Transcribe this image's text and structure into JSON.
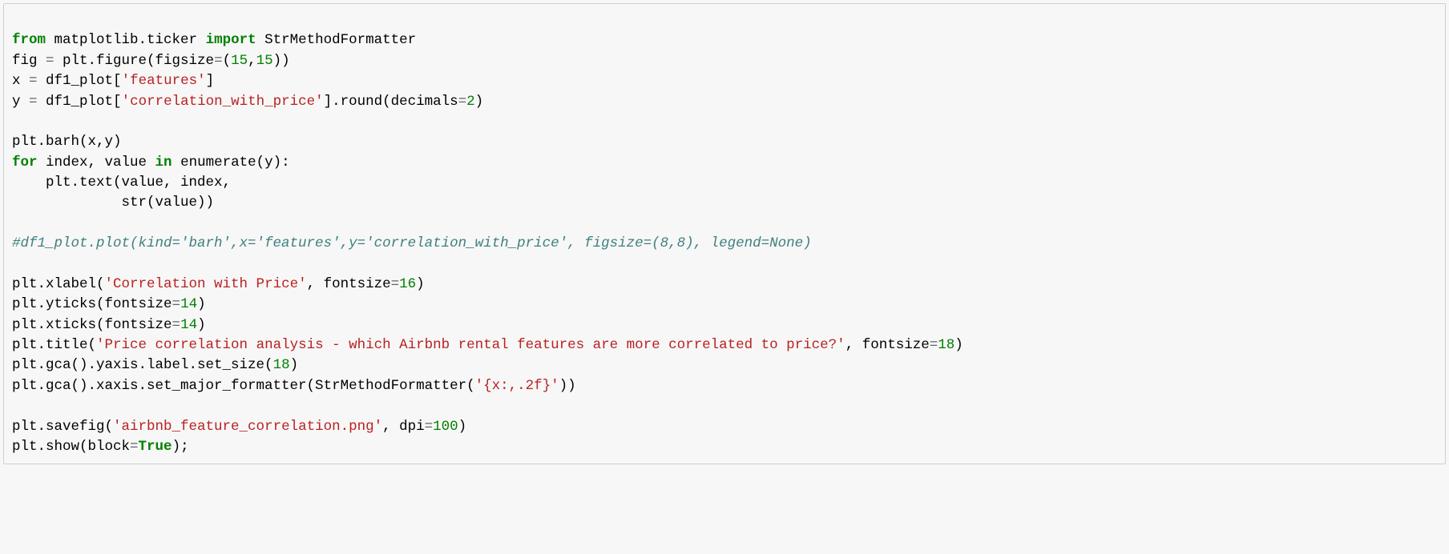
{
  "code": {
    "l1": {
      "kw1": "from",
      "mod": " matplotlib.ticker ",
      "kw2": "import",
      "cls": " StrMethodFormatter"
    },
    "l2": {
      "a": "fig ",
      "eq": "=",
      "b": " plt.figure(figsize",
      "eq2": "=",
      "c": "(",
      "n1": "15",
      "comma": ",",
      "n2": "15",
      "d": "))"
    },
    "l3": {
      "a": "x ",
      "eq": "=",
      "b": " df1_plot[",
      "s": "'features'",
      "c": "]"
    },
    "l4": {
      "a": "y ",
      "eq": "=",
      "b": " df1_plot[",
      "s": "'correlation_with_price'",
      "c": "].round(decimals",
      "eq2": "=",
      "n": "2",
      "d": ")"
    },
    "l5": "",
    "l6": {
      "a": "plt.barh(x,y)"
    },
    "l7": {
      "kw1": "for",
      "a": " index, value ",
      "kw2": "in",
      "b": " enumerate(y):"
    },
    "l8": {
      "a": "    plt.text(value, index,"
    },
    "l9": {
      "a": "             str(value))"
    },
    "l10": "",
    "l11": {
      "c": "#df1_plot.plot(kind='barh',x='features',y='correlation_with_price', figsize=(8,8), legend=None)"
    },
    "l12": "",
    "l13": {
      "a": "plt.xlabel(",
      "s": "'Correlation with Price'",
      "b": ", fontsize",
      "eq": "=",
      "n": "16",
      "c": ")"
    },
    "l14": {
      "a": "plt.yticks(fontsize",
      "eq": "=",
      "n": "14",
      "b": ")"
    },
    "l15": {
      "a": "plt.xticks(fontsize",
      "eq": "=",
      "n": "14",
      "b": ")"
    },
    "l16": {
      "a": "plt.title(",
      "s": "'Price correlation analysis - which Airbnb rental features are more correlated to price?'",
      "b": ", fontsize",
      "eq": "=",
      "n": "18",
      "c": ")"
    },
    "l17": {
      "a": "plt.gca().yaxis.label.set_size(",
      "n": "18",
      "b": ")"
    },
    "l18": {
      "a": "plt.gca().xaxis.set_major_formatter(StrMethodFormatter(",
      "s": "'{x:,.2f}'",
      "b": "))"
    },
    "l19": "",
    "l20": {
      "a": "plt.savefig(",
      "s": "'airbnb_feature_correlation.png'",
      "b": ", dpi",
      "eq": "=",
      "n": "100",
      "c": ")"
    },
    "l21": {
      "a": "plt.show(block",
      "eq": "=",
      "boo": "True",
      "b": ");"
    }
  }
}
